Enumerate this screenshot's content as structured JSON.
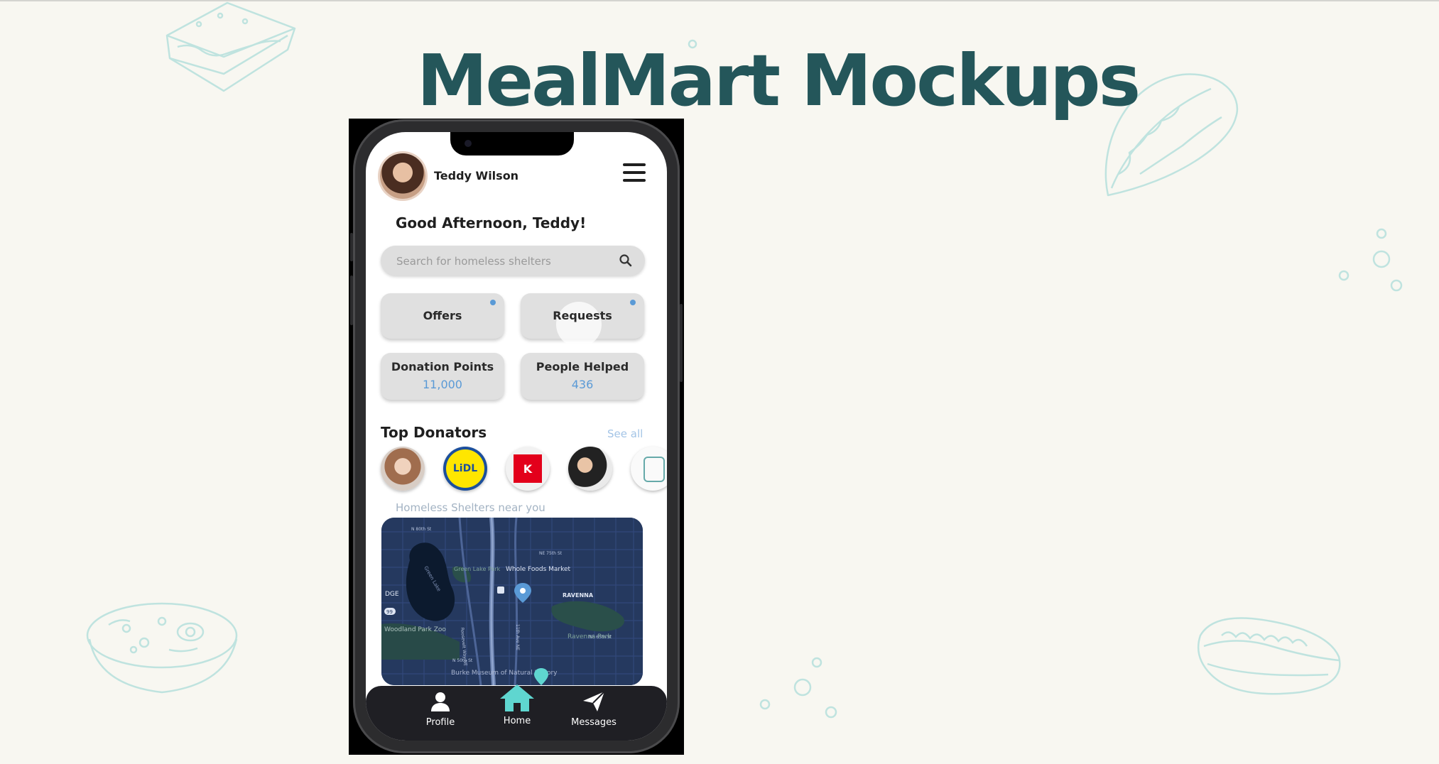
{
  "page": {
    "title": "MealMart Mockups",
    "background": "#f8f7f1",
    "title_color": "#24565a"
  },
  "app": {
    "user": {
      "name": "Teddy Wilson",
      "avatar_icon": "user-avatar"
    },
    "greeting": "Good Afternoon, Teddy!",
    "search": {
      "placeholder": "Search for homeless shelters",
      "value": ""
    },
    "actions": [
      {
        "label": "Offers",
        "has_notification": true
      },
      {
        "label": "Requests",
        "has_notification": true
      }
    ],
    "stats": [
      {
        "label": "Donation Points",
        "value": "11,000"
      },
      {
        "label": "People Helped",
        "value": "436"
      }
    ],
    "top_donators": {
      "title": "Top Donators",
      "see_all": "See all",
      "logo_text": {
        "lidl": "LiDL",
        "kaufland": "K"
      }
    },
    "map": {
      "label": "Homeless Shelters near you",
      "places": {
        "store": "Whole Foods Market",
        "district": "RAVENNA",
        "park": "Ravenna Park",
        "zoo": "Woodland Park Zoo",
        "lake": "Green Lake",
        "lake_park": "Green Lake Park",
        "museum": "Burke Museum of Natural History",
        "left_edge": "DGE",
        "ramp": "99",
        "street_1": "N 80th St",
        "street_2": "NE 75th St",
        "street_3": "NE 65th St",
        "street_4": "N 50th St",
        "avenue": "11th Ave NE",
        "avenue_2": "Roosevelt Way NE"
      }
    },
    "nav": [
      {
        "label": "Profile",
        "icon": "person-icon"
      },
      {
        "label": "Home",
        "icon": "home-icon",
        "active": true
      },
      {
        "label": "Messages",
        "icon": "send-icon"
      }
    ],
    "colors": {
      "accent": "#5a9ad6",
      "active_nav": "#5fd6d0",
      "nav_bar": "#1f1f24",
      "card": "#e0e0e0",
      "map_bg": "#253a63"
    }
  }
}
